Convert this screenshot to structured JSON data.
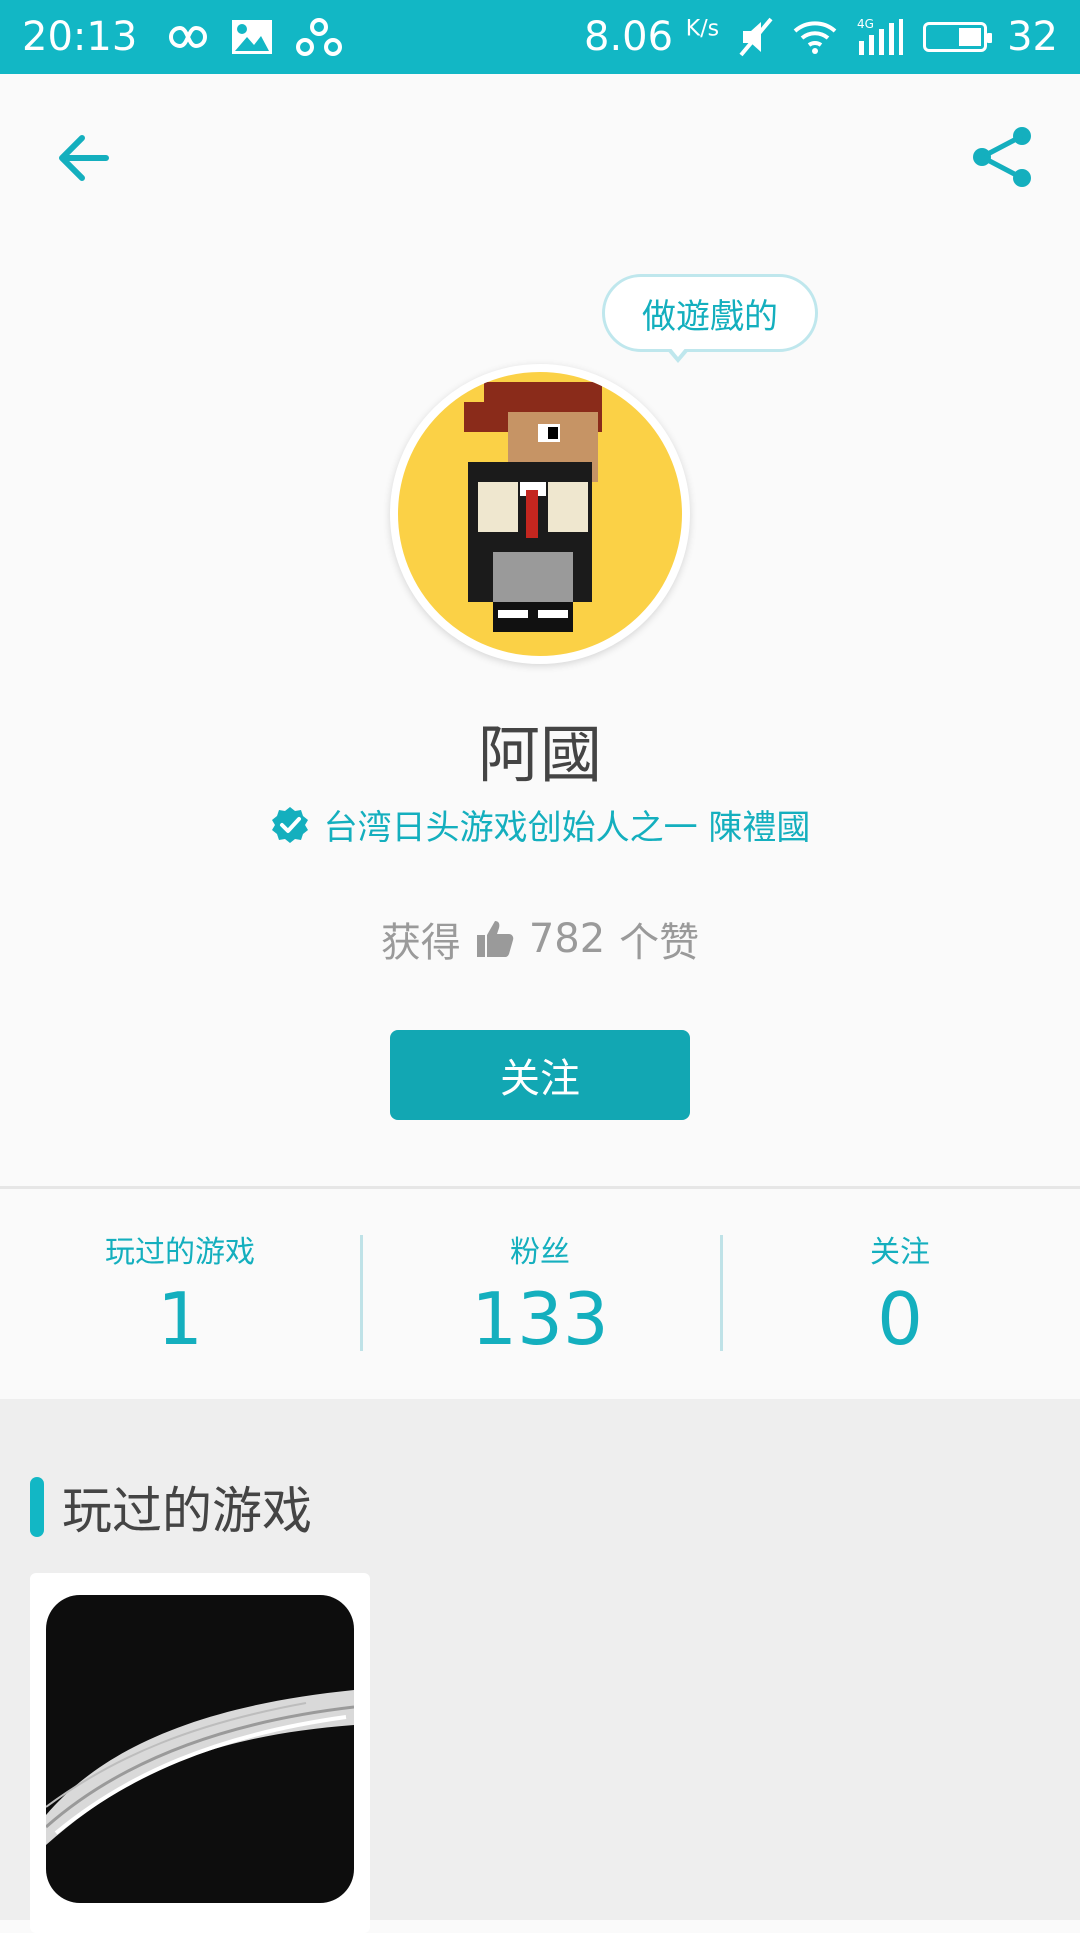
{
  "status_bar": {
    "time": "20:13",
    "speed_value": "8.06",
    "speed_unit": "K/s",
    "network_label": "4G",
    "battery_level": "32"
  },
  "header": {
    "back_icon": "arrow-left-icon",
    "share_icon": "share-icon"
  },
  "profile": {
    "bubble_text": "做遊戲的",
    "name": "阿國",
    "verified_text": "台湾日头游戏创始人之一 陳禮國",
    "likes_prefix": "获得",
    "likes_count": "782",
    "likes_suffix": "个赞",
    "follow_label": "关注"
  },
  "stats": [
    {
      "label": "玩过的游戏",
      "value": "1"
    },
    {
      "label": "粉丝",
      "value": "133"
    },
    {
      "label": "关注",
      "value": "0"
    }
  ],
  "section": {
    "title": "玩过的游戏"
  },
  "colors": {
    "accent": "#12b7c5",
    "button": "#12a7b3",
    "avatar_bg": "#fbd146"
  }
}
